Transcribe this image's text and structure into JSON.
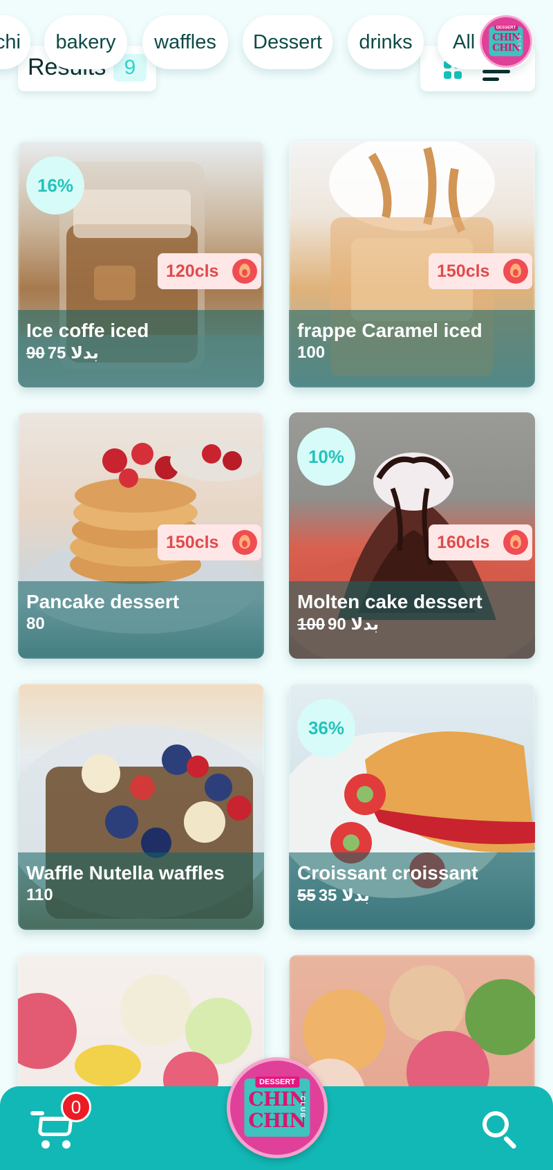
{
  "header": {
    "results_label": "Results",
    "results_count": "9"
  },
  "categories": [
    "chi",
    "bakery",
    "waffles",
    "Dessert",
    "drinks",
    "All"
  ],
  "brand": {
    "badge": "DESSERT",
    "word_top": "CHIN",
    "word_bottom": "CHIN",
    "club": "CLUB"
  },
  "products": [
    {
      "title": "Ice coffe iced",
      "old_price": "90",
      "price": "75 بدلا",
      "discount": "16%",
      "calories": "120cls"
    },
    {
      "title": "frappe Caramel iced",
      "old_price": "",
      "price": "100",
      "discount": "",
      "calories": "150cls"
    },
    {
      "title": "Pancake dessert",
      "old_price": "",
      "price": "80",
      "discount": "",
      "calories": "150cls"
    },
    {
      "title": "Molten cake dessert",
      "old_price": "100",
      "price": "90 بدلا",
      "discount": "10%",
      "calories": "160cls"
    },
    {
      "title": "Waffle Nutella waffles",
      "old_price": "",
      "price": "110",
      "discount": "",
      "calories": ""
    },
    {
      "title": "Croissant croissant",
      "old_price": "55",
      "price": "35 بدلا",
      "discount": "36%",
      "calories": ""
    }
  ],
  "cart": {
    "count": "0"
  },
  "colors": {
    "accent": "#12b8b5",
    "background": "#f1fcfc",
    "discount_text": "#23c3bb",
    "calorie_text": "#e14a4a",
    "brand_pink": "#e0409a"
  },
  "icons": {
    "grid_view": "grid-view-icon",
    "list_view": "list-view-icon",
    "calories": "flame-icon",
    "cart": "cart-icon",
    "search": "search-icon"
  }
}
